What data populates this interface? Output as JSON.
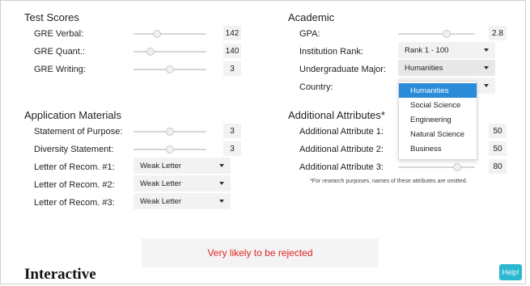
{
  "test_scores": {
    "title": "Test Scores",
    "rows": [
      {
        "label": "GRE Verbal:",
        "value": "142",
        "level": 0.3
      },
      {
        "label": "GRE Quant.:",
        "value": "140",
        "level": 0.2
      },
      {
        "label": "GRE Writing:",
        "value": "3",
        "level": 0.5
      }
    ]
  },
  "academic": {
    "title": "Academic",
    "gpa": {
      "label": "GPA:",
      "value": "2.8",
      "level": 0.65
    },
    "institution_rank": {
      "label": "Institution Rank:",
      "value": "Rank 1 - 100"
    },
    "undergraduate_major": {
      "label": "Undergraduate Major:",
      "value": "Humanities",
      "options": [
        "Humanities",
        "Social Science",
        "Engineering",
        "Natural Science",
        "Business"
      ]
    },
    "country": {
      "label": "Country:"
    }
  },
  "application_materials": {
    "title": "Application Materials",
    "sliders": [
      {
        "label": "Statement of Purpose:",
        "value": "3",
        "level": 0.5
      },
      {
        "label": "Diversity Statement:",
        "value": "3",
        "level": 0.5
      }
    ],
    "letters": [
      {
        "label": "Letter of Recom. #1:",
        "value": "Weak Letter"
      },
      {
        "label": "Letter of Recom. #2:",
        "value": "Weak Letter"
      },
      {
        "label": "Letter of Recom. #3:",
        "value": "Weak Letter"
      }
    ]
  },
  "additional_attributes": {
    "title": "Additional Attributes*",
    "rows": [
      {
        "label": "Additional Attribute 1:",
        "value": "50"
      },
      {
        "label": "Additional Attribute 2:",
        "value": "50"
      },
      {
        "label": "Additional Attribute 3:",
        "value": "80",
        "level": 0.8
      }
    ],
    "footnote": "*For research purposes, names of these attributes are omitted."
  },
  "result_text": "Very likely to be rejected",
  "help_label": "Help!",
  "caption": "Interactive",
  "colors": {
    "result": "#e02424",
    "help": "#2ab7cf",
    "selected_option": "#2a8bd8"
  }
}
